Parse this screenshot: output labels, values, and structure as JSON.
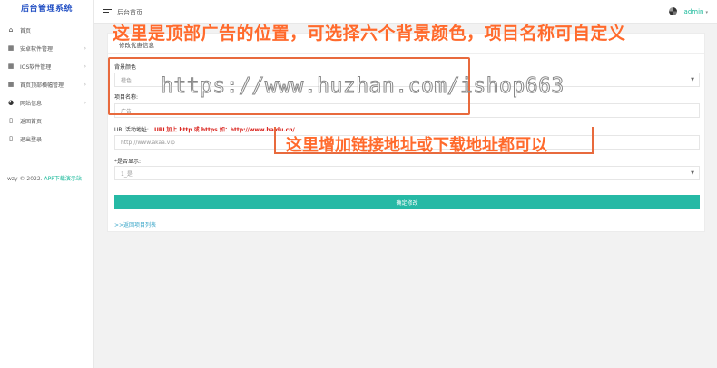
{
  "app": {
    "title": "后台管理系统"
  },
  "sidebar": {
    "items": [
      {
        "label": "首页",
        "icon": "home-icon",
        "has_children": false
      },
      {
        "label": "安卓软件管理",
        "icon": "grid-icon",
        "has_children": true
      },
      {
        "label": "IOS软件管理",
        "icon": "grid-icon",
        "has_children": true
      },
      {
        "label": "首页顶部横幅管理",
        "icon": "grid-icon",
        "has_children": true
      },
      {
        "label": "网站信息",
        "icon": "palette-icon",
        "has_children": true
      },
      {
        "label": "返回首页",
        "icon": "page-icon",
        "has_children": false
      },
      {
        "label": "退出登录",
        "icon": "page-icon",
        "has_children": false
      }
    ],
    "footer_text": "wzy © 2022.",
    "footer_link": "APP下载演示站"
  },
  "header": {
    "breadcrumb": "后台首页",
    "user": "admin"
  },
  "form": {
    "title": "修改优惠信息",
    "bg_color_label": "背景颜色",
    "bg_color_value": "橙色",
    "name_label": "项目名称:",
    "name_placeholder": "广告一",
    "url_label": "URL活动地址:",
    "url_hint": "URL加上 http 或 https 如：http://www.baidu.cn/",
    "url_placeholder": "http://www.akaa.vip",
    "show_label": "*是否显示:",
    "show_value": "1_是",
    "submit_label": "确定修改",
    "back_label": ">>返回项目列表"
  },
  "annotations": {
    "top_note": "这里是顶部广告的位置，可选择六个背景颜色，项目名称可自定义",
    "url_note": "这里增加链接地址或下载地址都可以",
    "watermark": "https://www.huzhan.com/ishop663"
  },
  "colors": {
    "accent": "#26b9a5",
    "annotation": "#ff6a2c",
    "logo": "#2a56c6",
    "hint": "#d9211b"
  }
}
